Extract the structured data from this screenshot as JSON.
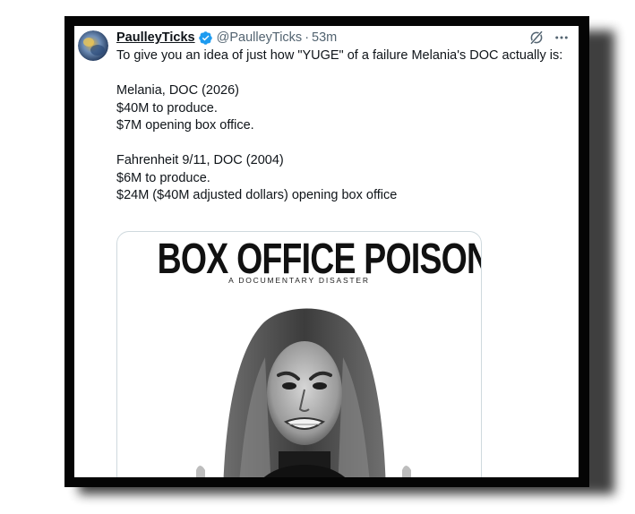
{
  "tweet": {
    "display_name": "PaulleyTicks",
    "handle": "@PaulleyTicks",
    "separator": "·",
    "time": "53m",
    "text_lines": [
      "To give you an idea of just how \"YUGE\" of a failure Melania's DOC actually is:",
      "",
      "Melania, DOC (2026)",
      "$40M to produce.",
      "$7M opening box office.",
      "",
      "Fahrenheit 9/11, DOC (2004)",
      "$6M to produce.",
      "$24M ($40M adjusted dollars) opening box office"
    ]
  },
  "media": {
    "poster_title": "BOX OFFICE POISON",
    "poster_subtitle": "A DOCUMENTARY DISASTER"
  },
  "icons": {
    "verified": "verified-badge-icon",
    "grok": "grok-icon",
    "more": "more-options-icon"
  },
  "colors": {
    "verified_blue": "#1d9bf0",
    "text_primary": "#0f1419",
    "text_secondary": "#536471",
    "frame": "#050505"
  }
}
